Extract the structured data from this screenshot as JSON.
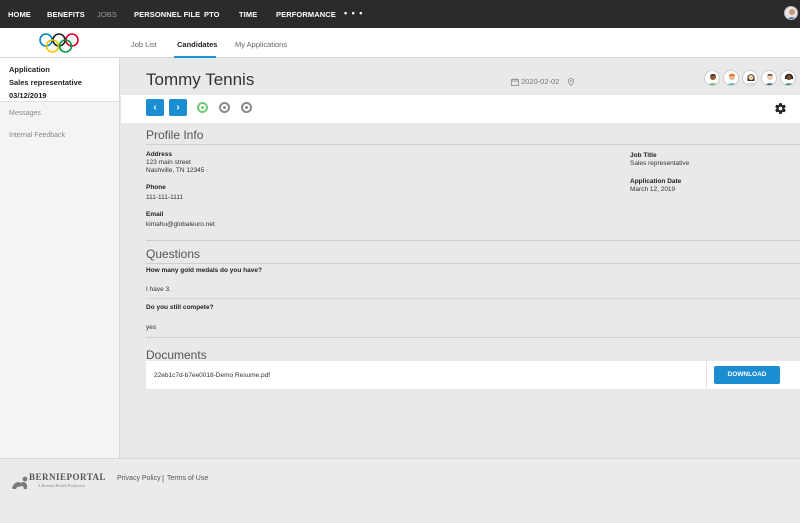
{
  "topnav": {
    "items": [
      {
        "label": "HOME"
      },
      {
        "label": "BENEFITS"
      },
      {
        "label": "JOBS"
      },
      {
        "label": "PERSONNEL FILE"
      },
      {
        "label": "PTO"
      },
      {
        "label": "TIME"
      },
      {
        "label": "PERFORMANCE"
      }
    ],
    "more": "• • •",
    "active": "JOBS"
  },
  "subnav": {
    "tabs": [
      {
        "label": "Job List"
      },
      {
        "label": "Candidates"
      },
      {
        "label": "My Applications"
      }
    ],
    "active": "Candidates"
  },
  "sidebar": {
    "application_heading": "Application",
    "position": "Sales representative",
    "date": "03/12/2019",
    "links": [
      {
        "label": "Messages"
      },
      {
        "label": "Internal Feedback"
      }
    ]
  },
  "candidate": {
    "name": "Tommy Tennis",
    "date": "2020-02-02"
  },
  "profile": {
    "title": "Profile Info",
    "address_label": "Address",
    "address_line1": "123 main street",
    "address_line2": "Nashville, TN 12345",
    "phone_label": "Phone",
    "phone": "111-111-1111",
    "email_label": "Email",
    "email": "kimahu@globaleuro.net",
    "job_title_label": "Job Title",
    "job_title": "Sales representative",
    "app_date_label": "Application Date",
    "app_date": "March 12, 2019"
  },
  "questions": {
    "title": "Questions",
    "items": [
      {
        "q": "How many gold medals do you have?",
        "a": "I have 3."
      },
      {
        "q": "Do you still compete?",
        "a": "yes"
      }
    ]
  },
  "documents": {
    "title": "Documents",
    "file": "22eb1c7d-b7ee0018-Demo Resume.pdf",
    "download_label": "DOWNLOAD"
  },
  "footer": {
    "brand": "BERNIEPORTAL",
    "tagline": "A Bernard Health Production",
    "privacy": "Privacy Policy",
    "separator": "|",
    "terms": "Terms of Use"
  },
  "colors": {
    "accent": "#1a8ed0",
    "nav_bg": "#2b2b2b",
    "step_done": "#6fcb74"
  }
}
